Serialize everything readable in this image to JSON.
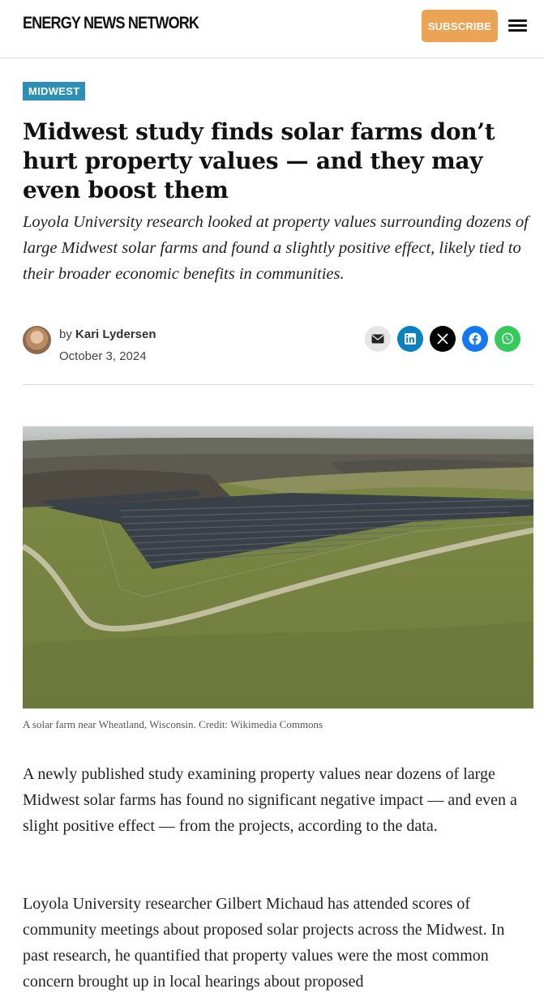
{
  "header": {
    "logo": "ENERGY NEWS NETWORK",
    "subscribe_label": "SUBSCRIBE",
    "menu_icon": "hamburger-menu-icon"
  },
  "article": {
    "category": "MIDWEST",
    "title": "Midwest study finds solar farms don’t hurt property values — and they may even boost them",
    "dek": "Loyola University research looked at property values surrounding dozens of large Midwest solar farms and found a slightly positive effect, likely tied to their broader economic benefits in communities.",
    "byline": {
      "prefix": "by",
      "author": "Kari Lydersen",
      "date": "October 3, 2024"
    },
    "share_icons": [
      "email-icon",
      "linkedin-icon",
      "x-icon",
      "facebook-icon",
      "whatsapp-icon"
    ],
    "image": {
      "alt": "solar farm aerial photo",
      "caption": "A solar farm near Wheatland, Wisconsin. Credit: Wikimedia Commons"
    },
    "paragraphs": [
      "A newly published study examining property values near dozens of large Midwest solar farms has found no significant negative impact — and even a slight positive effect — from the projects, according to the data.",
      "Loyola University researcher Gilbert Michaud has attended scores of community meetings about proposed solar projects across the Midwest. In past research, he quantified that property values were the most common concern brought up in local hearings about proposed"
    ]
  },
  "colors": {
    "subscribe": "#eba456",
    "tag": "#2b8fb6",
    "linkedin": "#0a82c2",
    "facebook": "#1478f2",
    "whatsapp": "#36c95b"
  }
}
